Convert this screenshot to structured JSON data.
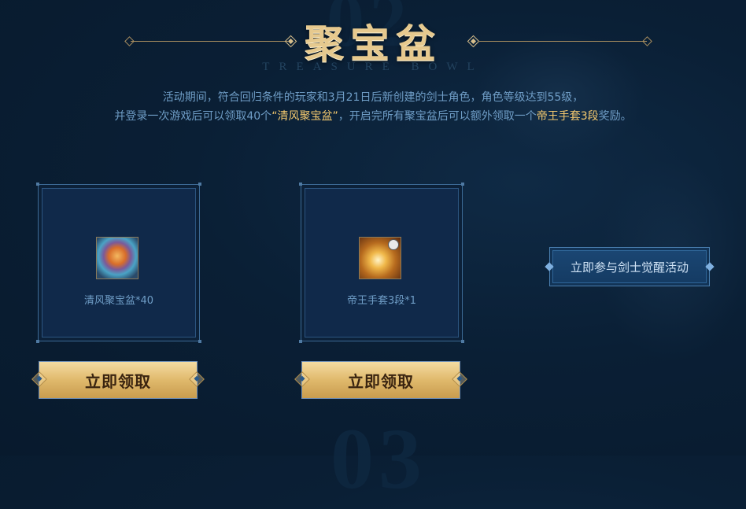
{
  "background": {
    "top_number": "02",
    "bottom_number": "03"
  },
  "section": {
    "title": "聚宝盆",
    "subtitle": "TREASURE BOWL"
  },
  "description": {
    "line1": "活动期间，符合回归条件的玩家和3月21日后新创建的剑士角色，角色等级达到55级，",
    "line2_part1": "并登录一次游戏后可以领取40个",
    "line2_highlight1": "“清风聚宝盆”",
    "line2_part2": "，开启完所有聚宝盆后可以额外领取一个",
    "line2_highlight2": "帝王手套3段",
    "line2_part3": "奖励。"
  },
  "rewards": [
    {
      "name": "清风聚宝盆*40",
      "icon": "treasure-bowl-icon",
      "button": "立即领取"
    },
    {
      "name": "帝王手套3段*1",
      "icon": "emperor-glove-icon",
      "button": "立即领取"
    }
  ],
  "join_button": "立即参与剑士觉醒活动",
  "colors": {
    "background": "#0a1f35",
    "highlight": "#f3c86e",
    "text": "#6f9dc6",
    "gold_button": "#e0b96c"
  }
}
